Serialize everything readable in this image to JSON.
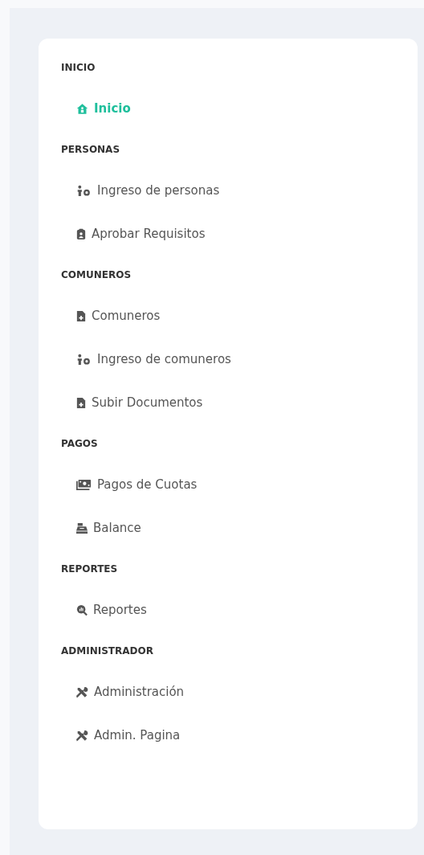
{
  "sidebar": {
    "sections": [
      {
        "title": "INICIO",
        "items": [
          {
            "label": "Inicio",
            "kind": "home",
            "selected": true
          }
        ]
      },
      {
        "title": "PERSONAS",
        "items": [
          {
            "label": "Ingreso de personas",
            "kind": "person-add",
            "selected": false
          },
          {
            "label": "Aprobar Requisitos",
            "kind": "badge",
            "selected": false
          }
        ]
      },
      {
        "title": "COMUNEROS",
        "items": [
          {
            "label": "Comuneros",
            "kind": "file",
            "selected": false
          },
          {
            "label": "Ingreso de comuneros",
            "kind": "person-add",
            "selected": false
          },
          {
            "label": "Subir Documentos",
            "kind": "file",
            "selected": false
          }
        ]
      },
      {
        "title": "PAGOS",
        "items": [
          {
            "label": "Pagos de Cuotas",
            "kind": "money",
            "selected": false
          },
          {
            "label": "Balance",
            "kind": "register",
            "selected": false
          }
        ]
      },
      {
        "title": "REPORTES",
        "items": [
          {
            "label": "Reportes",
            "kind": "search",
            "selected": false
          }
        ]
      },
      {
        "title": "ADMINISTRADOR",
        "items": [
          {
            "label": "Administración",
            "kind": "tools",
            "selected": false
          },
          {
            "label": "Admin. Pagina",
            "kind": "tools",
            "selected": false
          }
        ]
      }
    ]
  }
}
